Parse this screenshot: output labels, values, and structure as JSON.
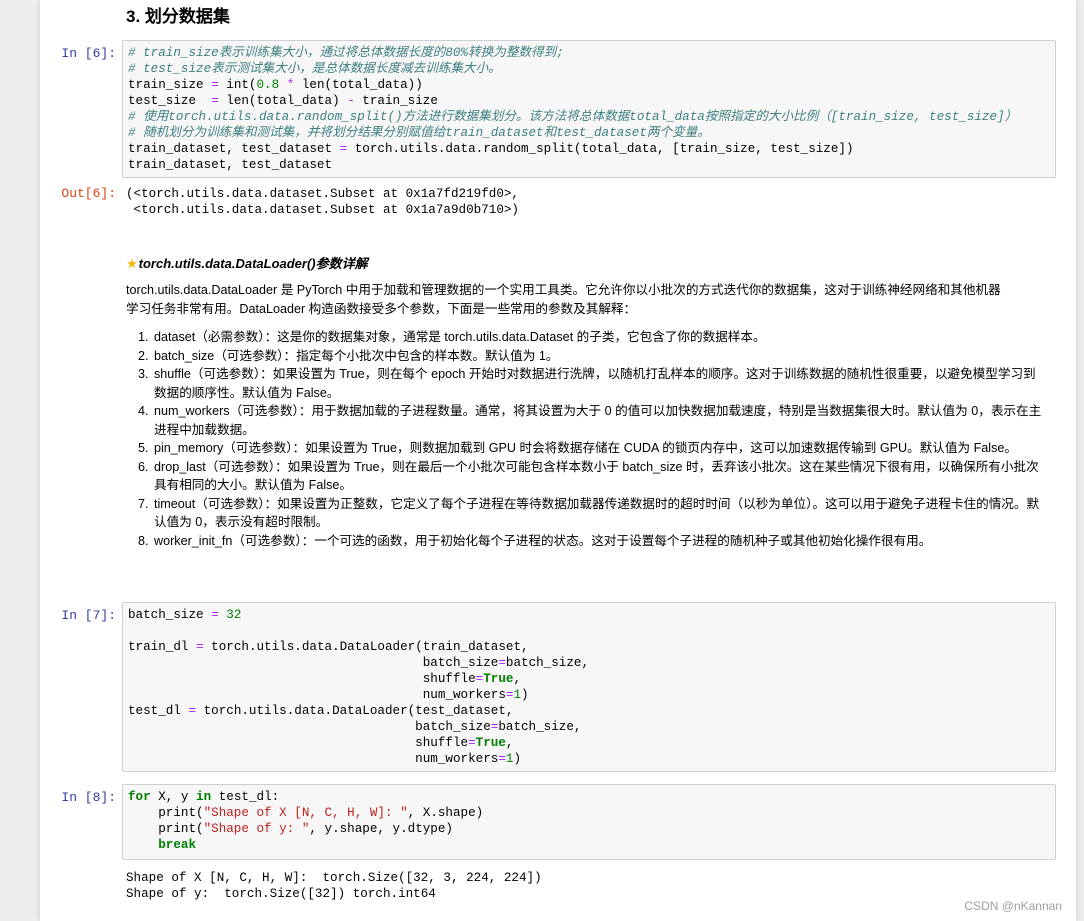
{
  "section_heading": "3. 划分数据集",
  "cell6": {
    "in_prompt": "In [6]:",
    "out_prompt": "Out[6]:",
    "lines": [
      [
        {
          "t": "# train_size表示训练集大小，通过将总体数据长度的80%转换为整数得到;",
          "c": "cm"
        }
      ],
      [
        {
          "t": "# test_size表示测试集大小，是总体数据长度减去训练集大小。",
          "c": "cm"
        }
      ],
      [
        {
          "t": "train_size "
        },
        {
          "t": "=",
          "c": "op"
        },
        {
          "t": " int("
        },
        {
          "t": "0.8",
          "c": "nu"
        },
        {
          "t": " "
        },
        {
          "t": "*",
          "c": "op"
        },
        {
          "t": " len(total_data))"
        }
      ],
      [
        {
          "t": "test_size  "
        },
        {
          "t": "=",
          "c": "op"
        },
        {
          "t": " len(total_data) "
        },
        {
          "t": "-",
          "c": "op"
        },
        {
          "t": " train_size"
        }
      ],
      [
        {
          "t": "# 使用torch.utils.data.random_split()方法进行数据集划分。该方法将总体数据total_data按照指定的大小比例（[train_size, test_size]）",
          "c": "cm"
        }
      ],
      [
        {
          "t": "# 随机划分为训练集和测试集，并将划分结果分别赋值给train_dataset和test_dataset两个变量。",
          "c": "cm"
        }
      ],
      [
        {
          "t": "train_dataset, test_dataset "
        },
        {
          "t": "=",
          "c": "op"
        },
        {
          "t": " torch.utils.data.random_split(total_data, [train_size, test_size])"
        }
      ],
      [
        {
          "t": "train_dataset, test_dataset"
        }
      ]
    ],
    "output": "(<torch.utils.data.dataset.Subset at 0x1a7fd219fd0>,\n <torch.utils.data.dataset.Subset at 0x1a7a9d0b710>)"
  },
  "markdown": {
    "star_icon": "★",
    "title": "torch.utils.data.DataLoader()参数详解",
    "intro_line1": "torch.utils.data.DataLoader 是 PyTorch 中用于加载和管理数据的一个实用工具类。它允许你以小批次的方式迭代你的数据集，这对于训练神经网络和其他机器",
    "intro_line2": "学习任务非常有用。DataLoader 构造函数接受多个参数，下面是一些常用的参数及其解释：",
    "params": [
      "dataset（必需参数）：这是你的数据集对象，通常是 torch.utils.data.Dataset 的子类，它包含了你的数据样本。",
      "batch_size（可选参数）：指定每个小批次中包含的样本数。默认值为 1。",
      "shuffle（可选参数）：如果设置为 True，则在每个 epoch 开始时对数据进行洗牌，以随机打乱样本的顺序。这对于训练数据的随机性很重要，以避免模型学习到数据的顺序性。默认值为 False。",
      "num_workers（可选参数）：用于数据加载的子进程数量。通常，将其设置为大于 0 的值可以加快数据加载速度，特别是当数据集很大时。默认值为 0，表示在主进程中加载数据。",
      "pin_memory（可选参数）：如果设置为 True，则数据加载到 GPU 时会将数据存储在 CUDA 的锁页内存中，这可以加速数据传输到 GPU。默认值为 False。",
      "drop_last（可选参数）：如果设置为 True，则在最后一个小批次可能包含样本数小于 batch_size 时，丢弃该小批次。这在某些情况下很有用，以确保所有小批次具有相同的大小。默认值为 False。",
      "timeout（可选参数）：如果设置为正整数，它定义了每个子进程在等待数据加载器传递数据时的超时时间（以秒为单位）。这可以用于避免子进程卡住的情况。默认值为 0，表示没有超时限制。",
      "worker_init_fn（可选参数）：一个可选的函数，用于初始化每个子进程的状态。这对于设置每个子进程的随机种子或其他初始化操作很有用。"
    ]
  },
  "cell7": {
    "in_prompt": "In [7]:",
    "lines": [
      [
        {
          "t": "batch_size "
        },
        {
          "t": "=",
          "c": "op"
        },
        {
          "t": " "
        },
        {
          "t": "32",
          "c": "nu"
        }
      ],
      [
        {
          "t": ""
        }
      ],
      [
        {
          "t": "train_dl "
        },
        {
          "t": "=",
          "c": "op"
        },
        {
          "t": " torch.utils.data.DataLoader(train_dataset,"
        }
      ],
      [
        {
          "t": "                                       batch_size"
        },
        {
          "t": "=",
          "c": "op"
        },
        {
          "t": "batch_size,"
        }
      ],
      [
        {
          "t": "                                       shuffle"
        },
        {
          "t": "=",
          "c": "op"
        },
        {
          "t": "True",
          "c": "kw"
        },
        {
          "t": ","
        }
      ],
      [
        {
          "t": "                                       num_workers"
        },
        {
          "t": "=",
          "c": "op"
        },
        {
          "t": "1",
          "c": "nu"
        },
        {
          "t": ")"
        }
      ],
      [
        {
          "t": "test_dl "
        },
        {
          "t": "=",
          "c": "op"
        },
        {
          "t": " torch.utils.data.DataLoader(test_dataset,"
        }
      ],
      [
        {
          "t": "                                      batch_size"
        },
        {
          "t": "=",
          "c": "op"
        },
        {
          "t": "batch_size,"
        }
      ],
      [
        {
          "t": "                                      shuffle"
        },
        {
          "t": "=",
          "c": "op"
        },
        {
          "t": "True",
          "c": "kw"
        },
        {
          "t": ","
        }
      ],
      [
        {
          "t": "                                      num_workers"
        },
        {
          "t": "=",
          "c": "op"
        },
        {
          "t": "1",
          "c": "nu"
        },
        {
          "t": ")"
        }
      ]
    ]
  },
  "cell8": {
    "in_prompt": "In [8]:",
    "lines": [
      [
        {
          "t": "for",
          "c": "kw"
        },
        {
          "t": " X, y "
        },
        {
          "t": "in",
          "c": "kw"
        },
        {
          "t": " test_dl:"
        }
      ],
      [
        {
          "t": "    print("
        },
        {
          "t": "\"Shape of X [N, C, H, W]: \"",
          "c": "st"
        },
        {
          "t": ", X.shape)"
        }
      ],
      [
        {
          "t": "    print("
        },
        {
          "t": "\"Shape of y: \"",
          "c": "st"
        },
        {
          "t": ", y.shape, y.dtype)"
        }
      ],
      [
        {
          "t": "    "
        },
        {
          "t": "break",
          "c": "kw"
        }
      ]
    ],
    "output": "Shape of X [N, C, H, W]:  torch.Size([32, 3, 224, 224])\nShape of y:  torch.Size([32]) torch.int64"
  },
  "watermark": "CSDN @nKannan"
}
